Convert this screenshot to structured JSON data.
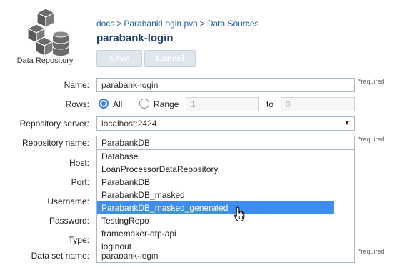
{
  "header": {
    "logo_label": "Data Repository",
    "breadcrumb": [
      "docs",
      "ParabankLogin.pva",
      "Data Sources"
    ],
    "title": "parabank-login",
    "save_label": "Save",
    "cancel_label": "Cancel"
  },
  "form": {
    "name_label": "Name:",
    "name_value": "parabank-login",
    "required_text": "*required",
    "rows_label": "Rows:",
    "rows_all": "All",
    "rows_range": "Range",
    "range_from": "1",
    "range_to_label": "to",
    "range_to": "0",
    "server_label": "Repository server:",
    "server_value": "localhost:2424",
    "repo_name_label": "Repository name:",
    "repo_name_value": "ParabankDB",
    "host_label": "Host:",
    "port_label": "Port:",
    "username_label": "Username:",
    "password_label": "Password:",
    "type_label": "Type:",
    "dataset_label": "Data set name:",
    "dataset_value": "parabank-login"
  },
  "dropdown": {
    "options": [
      "Database",
      "LoanProcessorDataRepository",
      "ParabankDB",
      "ParabankDB_masked",
      "ParabankDB_masked_generated",
      "TestingRepo",
      "framemaker-dtp-api",
      "loginout"
    ],
    "highlighted": "ParabankDB_masked_generated"
  },
  "colors": {
    "accent": "#3d8eee",
    "title": "#1c3f6e",
    "link": "#1f5ea8"
  }
}
